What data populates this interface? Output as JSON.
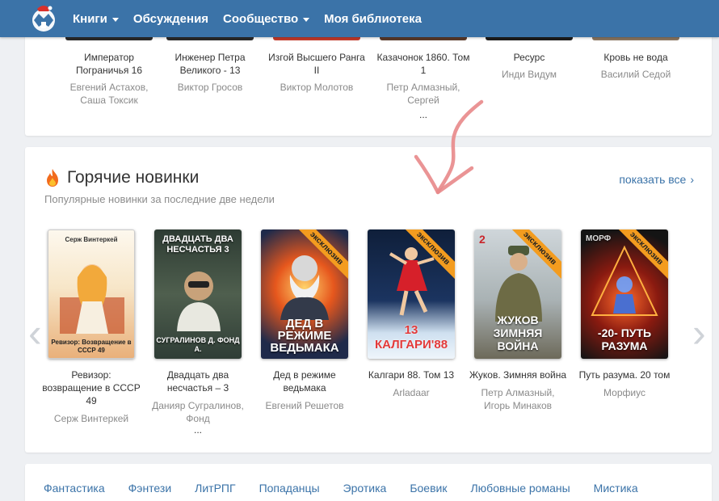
{
  "nav": {
    "items": [
      {
        "label": "Книги",
        "dropdown": true
      },
      {
        "label": "Обсуждения",
        "dropdown": false
      },
      {
        "label": "Сообщество",
        "dropdown": true
      },
      {
        "label": "Моя библиотека",
        "dropdown": false
      }
    ]
  },
  "top_books": [
    {
      "title": "Император Пограничья 16",
      "author": "Евгений Астахов, Саша Токсик",
      "extra": ""
    },
    {
      "title": "Инженер Петра Великого - 13",
      "author": "Виктор Гросов",
      "extra": ""
    },
    {
      "title": "Изгой Высшего Ранга II",
      "author": "Виктор Молотов",
      "extra": ""
    },
    {
      "title": "Казачонок 1860. Том 1",
      "author": "Петр Алмазный, Сергей",
      "extra": "..."
    },
    {
      "title": "Ресурс",
      "author": "Инди Видум",
      "extra": ""
    },
    {
      "title": "Кровь не вода",
      "author": "Василий Седой",
      "extra": ""
    }
  ],
  "hot": {
    "title": "Горячие новинки",
    "subtitle": "Популярные новинки за последние две недели",
    "show_all": "показать все",
    "ribbon_label": "эксклюзив",
    "books": [
      {
        "title": "Ревизор: возвращение в СССР 49",
        "author": "Серж Винтеркей",
        "extra": "",
        "exclusive": false,
        "cover_top": "Серж Винтеркей",
        "cover_bottom": "Ревизор: Возвращение в СССР 49"
      },
      {
        "title": "Двадцать два несчастья – 3",
        "author": "Данияр Сугралинов, Фонд",
        "extra": "...",
        "exclusive": false,
        "cover_top": "ДВАДЦАТЬ ДВА НЕСЧАСТЬЯ 3",
        "cover_bottom": "СУГРАЛИНОВ Д. ФОНД А."
      },
      {
        "title": "Дед в режиме ведьмака",
        "author": "Евгений Решетов",
        "extra": "",
        "exclusive": true,
        "cover_top": "",
        "cover_bottom": "ДЕД В РЕЖИМЕ ВЕДЬМАКА"
      },
      {
        "title": "Калгари 88. Том 13",
        "author": "Arladaar",
        "extra": "",
        "exclusive": true,
        "cover_top": "",
        "cover_bottom": "13 КАЛГАРИ'88"
      },
      {
        "title": "Жуков. Зимняя война",
        "author": "Петр Алмазный, Игорь Минаков",
        "extra": "",
        "exclusive": true,
        "cover_top": "2",
        "cover_bottom": "ЖУКОВ ЗИМНЯЯ ВОЙНА"
      },
      {
        "title": "Путь разума. 20 том",
        "author": "Морфиус",
        "extra": "",
        "exclusive": true,
        "cover_top": "МОРФ",
        "cover_bottom": "-20- ПУТЬ РАЗУМА"
      }
    ]
  },
  "genres": [
    "Фантастика",
    "Фэнтези",
    "ЛитРПГ",
    "Попаданцы",
    "Эротика",
    "Боевик",
    "Любовные романы",
    "Мистика"
  ],
  "colors": {
    "nav_bg": "#3b73a8",
    "link": "#3b73a8",
    "ribbon": "#f39c1f",
    "annotation": "#e8888a"
  }
}
